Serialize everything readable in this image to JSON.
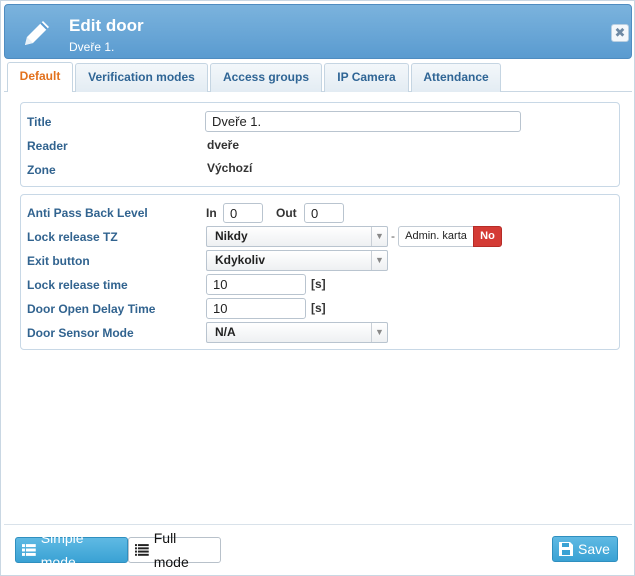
{
  "header": {
    "title": "Edit door",
    "subtitle": "Dveře 1.",
    "close_glyph": "✖",
    "pencil_icon": "pencil-icon",
    "color": "#5a9bd0"
  },
  "tabs": [
    {
      "label": "Default",
      "active": true
    },
    {
      "label": "Verification modes",
      "active": false
    },
    {
      "label": "Access groups",
      "active": false
    },
    {
      "label": "IP Camera",
      "active": false
    },
    {
      "label": "Attendance",
      "active": false
    }
  ],
  "general": {
    "title_label": "Title",
    "title_value": "Dveře 1.",
    "reader_label": "Reader",
    "reader_value": "dveře",
    "zone_label": "Zone",
    "zone_value": "Výchozí"
  },
  "settings": {
    "apb_label": "Anti Pass Back Level",
    "apb_in_label": "In",
    "apb_in_value": "0",
    "apb_out_label": "Out",
    "apb_out_value": "0",
    "lock_tz_label": "Lock release TZ",
    "lock_tz_value": "Nikdy",
    "lock_tz_dash": "-",
    "admin_card_label": "Admin. karta",
    "admin_card_state": "No",
    "exit_button_label": "Exit button",
    "exit_button_value": "Kdykoliv",
    "lock_time_label": "Lock release time",
    "lock_time_value": "10",
    "lock_time_unit": "[s]",
    "door_delay_label": "Door Open Delay Time",
    "door_delay_value": "10",
    "door_delay_unit": "[s]",
    "sensor_label": "Door Sensor Mode",
    "sensor_value": "N/A"
  },
  "footer": {
    "simple_mode_label": "Simple mode",
    "full_mode_label": "Full mode",
    "save_label": "Save"
  },
  "colors": {
    "accent": "#3aa2d4",
    "label_blue": "#31638f",
    "active_tab": "#e2711d",
    "danger": "#d43b35"
  }
}
